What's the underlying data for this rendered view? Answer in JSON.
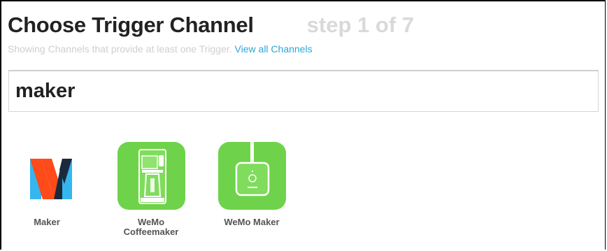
{
  "header": {
    "title": "Choose Trigger Channel",
    "step": "step 1 of 7",
    "subtitle_text": "Showing Channels that provide at least one Trigger.",
    "view_all_link": "View all Channels"
  },
  "search": {
    "value": "maker",
    "placeholder": ""
  },
  "channels": [
    {
      "label": "Maker",
      "icon": "maker-m-logo-icon"
    },
    {
      "label": "WeMo Coffeemaker",
      "label_line1": "WeMo",
      "label_line2": "Coffeemaker",
      "icon": "coffeemaker-icon",
      "color": "#6ed34a"
    },
    {
      "label": "WeMo Maker",
      "icon": "wemo-maker-device-icon",
      "color": "#6ed34a"
    }
  ],
  "colors": {
    "link": "#2ba7d8",
    "wemo_green": "#6ed34a",
    "maker_blue": "#35b6ee",
    "maker_red": "#ff4a1a",
    "maker_navy": "#1a2a3c"
  }
}
